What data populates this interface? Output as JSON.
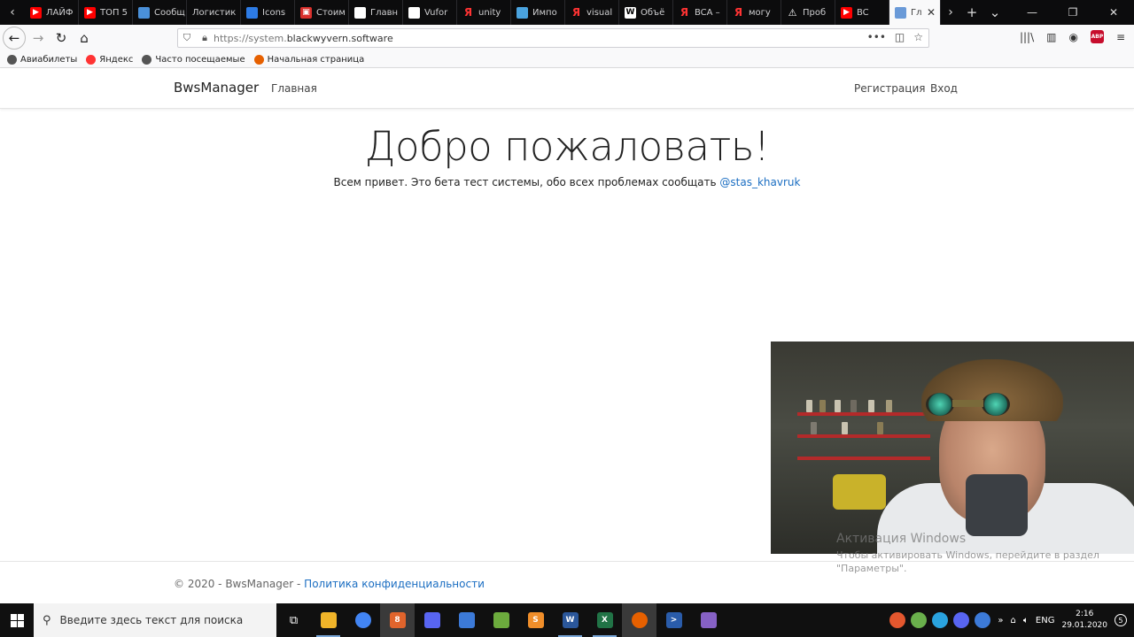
{
  "browser": {
    "tabs": [
      {
        "label": "ЛАЙФ",
        "icon": "youtube-icon",
        "color": "#ff0000"
      },
      {
        "label": "ТОП 5",
        "icon": "youtube-icon",
        "color": "#ff0000"
      },
      {
        "label": "Сообщ",
        "icon": "chat-icon",
        "color": "#4a90d9"
      },
      {
        "label": "Логистик",
        "icon": "",
        "color": ""
      },
      {
        "label": "Icons",
        "icon": "flag-icon",
        "color": "#2d7be5"
      },
      {
        "label": "Стоим",
        "icon": "pdf-icon",
        "color": "#d9302c"
      },
      {
        "label": "Главн",
        "icon": "page-icon",
        "color": "#ffffff"
      },
      {
        "label": "Vufor",
        "icon": "vuforia-icon",
        "color": "#ffffff"
      },
      {
        "label": "unity",
        "icon": "yandex-icon",
        "color": "#ff3333"
      },
      {
        "label": "Импо",
        "icon": "app-icon",
        "color": "#4aa3df"
      },
      {
        "label": "visual",
        "icon": "yandex-icon",
        "color": "#ff3333"
      },
      {
        "label": "Объё",
        "icon": "wikipedia-icon",
        "color": "#ffffff"
      },
      {
        "label": "BCA –",
        "icon": "yandex-icon",
        "color": "#ff3333"
      },
      {
        "label": "могу",
        "icon": "yandex-icon",
        "color": "#ff3333"
      },
      {
        "label": "Проб",
        "icon": "warning-icon",
        "color": "#ffffff"
      },
      {
        "label": "BC",
        "icon": "youtube-icon",
        "color": "#ff0000"
      },
      {
        "label": "Гл",
        "icon": "page-icon",
        "color": "#6a9ad8"
      }
    ],
    "url_prefix": "https://system.",
    "url_domain": "blackwyvern.software",
    "bookmarks": [
      {
        "label": "Авиабилеты",
        "icon": "globe-icon",
        "color": "#555555"
      },
      {
        "label": "Яндекс",
        "icon": "yandex-icon",
        "color": "#ff3333"
      },
      {
        "label": "Часто посещаемые",
        "icon": "gear-icon",
        "color": "#555555"
      },
      {
        "label": "Начальная страница",
        "icon": "firefox-icon",
        "color": "#e66000"
      }
    ]
  },
  "site": {
    "brand": "BwsManager",
    "nav_home": "Главная",
    "nav_register": "Регистрация",
    "nav_login": "Вход",
    "hero_title": "Добро пожаловать!",
    "hero_text": "Всем привет. Это бета тест системы, обо всех проблемах сообщать ",
    "hero_link": "@stas_khavruk",
    "footer_text": "© 2020 - BwsManager - ",
    "footer_link": "Политика конфиденциальности",
    "link_color": "#1b6ec2"
  },
  "overlay": {
    "activation_title": "Активация Windows",
    "activation_text": "Чтобы активировать Windows, перейдите в раздел \"Параметры\"."
  },
  "taskbar": {
    "search_placeholder": "Введите здесь текст для поиска",
    "apps": [
      {
        "name": "file-explorer-icon",
        "color": "#f0b429",
        "glyph": "",
        "state": "running"
      },
      {
        "name": "chrome-icon",
        "color": "#4285f4",
        "glyph": "",
        "state": ""
      },
      {
        "name": "telegram-icon",
        "color": "#e0642c",
        "glyph": "8",
        "state": "active"
      },
      {
        "name": "discord-icon",
        "color": "#5865f2",
        "glyph": "",
        "state": ""
      },
      {
        "name": "network-icon",
        "color": "#3c7ad8",
        "glyph": "",
        "state": ""
      },
      {
        "name": "git-icon",
        "color": "#6cab3d",
        "glyph": "",
        "state": ""
      },
      {
        "name": "sublime-icon",
        "color": "#f08e2a",
        "glyph": "S",
        "state": ""
      },
      {
        "name": "word-icon",
        "color": "#2b579a",
        "glyph": "W",
        "state": "running"
      },
      {
        "name": "excel-icon",
        "color": "#217346",
        "glyph": "X",
        "state": "running"
      },
      {
        "name": "firefox-icon",
        "color": "#e66000",
        "glyph": "",
        "state": "active"
      },
      {
        "name": "powershell-icon",
        "color": "#2a5caa",
        "glyph": ">",
        "state": ""
      },
      {
        "name": "visual-studio-icon",
        "color": "#8661c5",
        "glyph": "",
        "state": ""
      }
    ],
    "tray_apps": [
      {
        "name": "git-tray-icon",
        "color": "#e4572e"
      },
      {
        "name": "android-tray-icon",
        "color": "#6ab04c"
      },
      {
        "name": "telegram-tray-icon",
        "color": "#2aa3df"
      },
      {
        "name": "discord-tray-icon",
        "color": "#5865f2"
      },
      {
        "name": "network-tray-icon",
        "color": "#3c7ad8"
      }
    ],
    "language": "ENG",
    "time": "2:16",
    "date": "29.01.2020",
    "notification_count": "5"
  }
}
